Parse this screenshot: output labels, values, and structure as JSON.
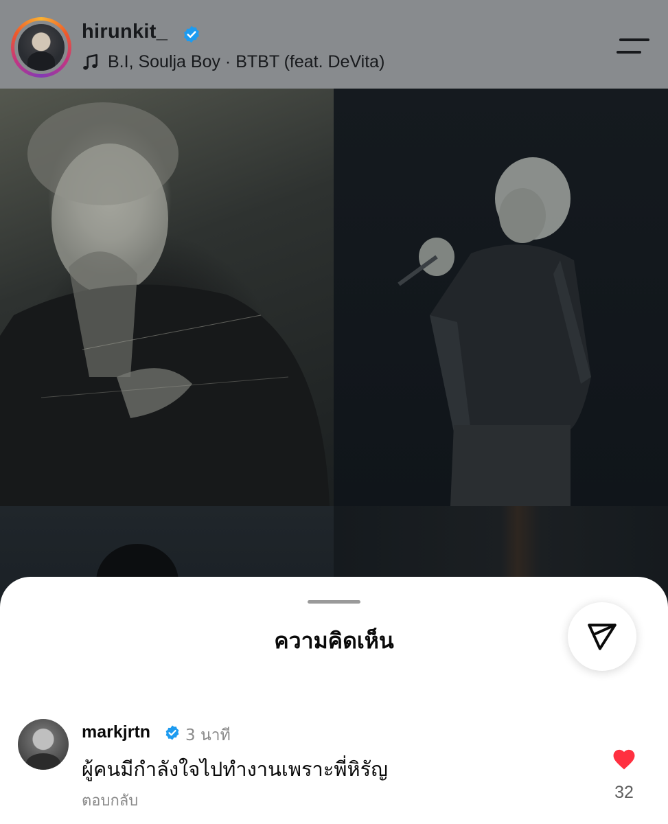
{
  "header": {
    "username": "hirunkit_",
    "verified": true,
    "music": {
      "icon": "music-note-icon",
      "track": "B.I, Soulja Boy · BTBT (feat. DeVita)"
    },
    "menu_icon": "menu-icon"
  },
  "media": {
    "tiles": [
      "photo-1",
      "photo-2",
      "photo-3",
      "photo-4"
    ]
  },
  "comments_sheet": {
    "title": "ความคิดเห็น",
    "share_icon": "send-icon",
    "comments": [
      {
        "username": "markjrtn",
        "verified": true,
        "time": "3 นาที",
        "text": "ผู้คนมีกำลังใจไปทำงานเพราะพี่หิรัญ",
        "reply_label": "ตอบกลับ",
        "likes": "32",
        "liked": true
      }
    ]
  },
  "colors": {
    "verified_blue": "#1d9bf0",
    "like_red": "#ff3040",
    "header_bg": "#888b8e"
  }
}
